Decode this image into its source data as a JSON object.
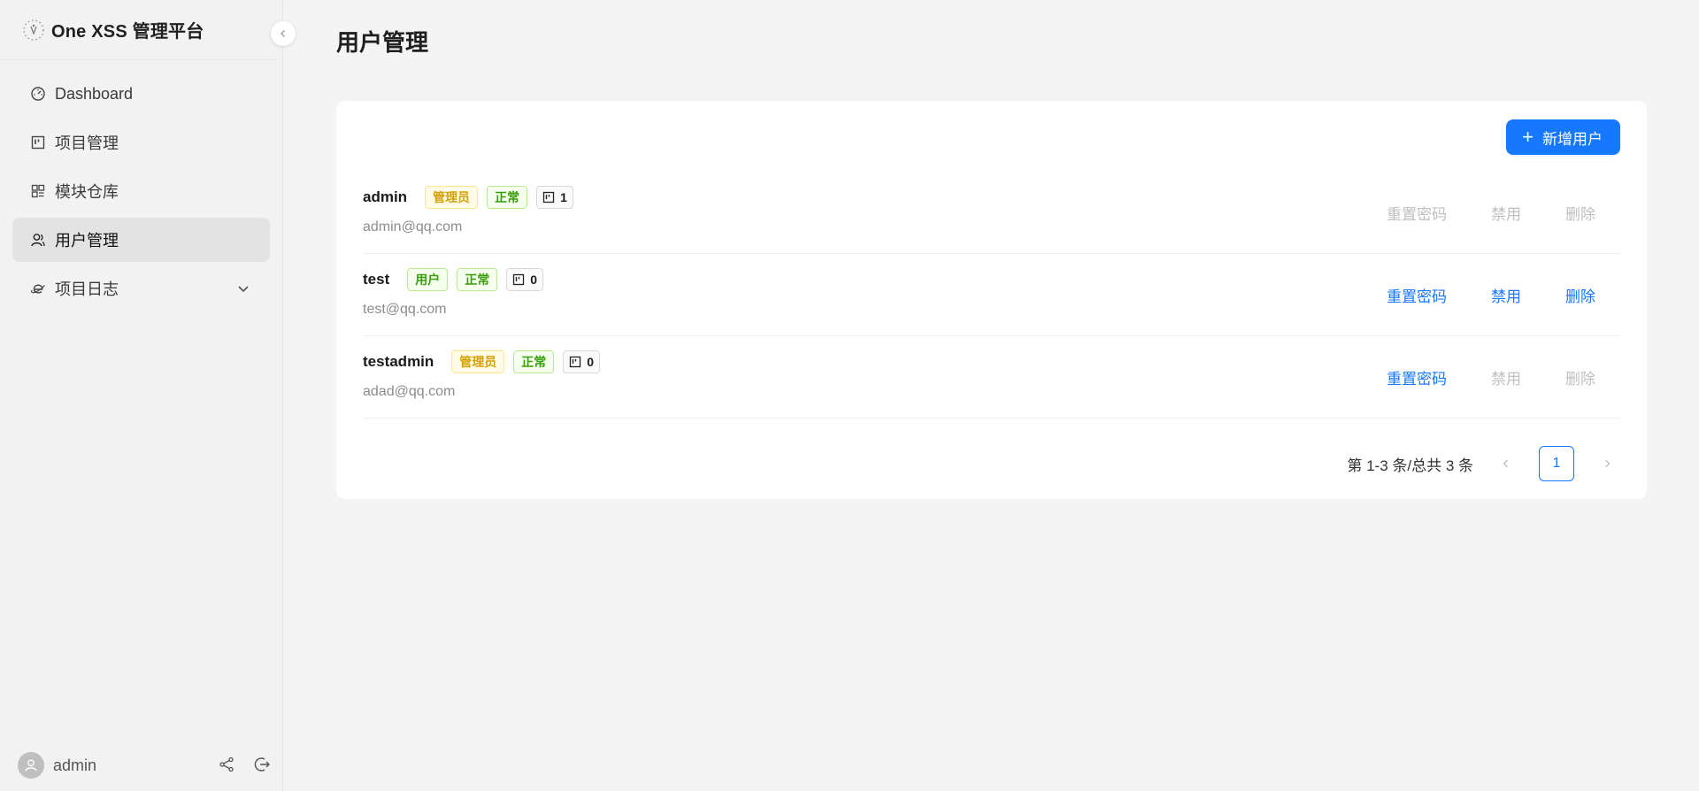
{
  "app": {
    "title": "One XSS 管理平台"
  },
  "sidebar": {
    "items": [
      {
        "label": "Dashboard",
        "icon": "dashboard-icon"
      },
      {
        "label": "项目管理",
        "icon": "project-icon"
      },
      {
        "label": "模块仓库",
        "icon": "module-icon"
      },
      {
        "label": "用户管理",
        "icon": "users-icon",
        "active": true
      },
      {
        "label": "项目日志",
        "icon": "log-icon",
        "expandable": true
      }
    ],
    "footer": {
      "username": "admin"
    }
  },
  "main": {
    "title": "用户管理",
    "add_button_label": "新增用户",
    "users": [
      {
        "name": "admin",
        "role": "管理员",
        "status": "正常",
        "projects": "1",
        "email": "admin@qq.com",
        "actions": {
          "reset": "重置密码",
          "disable": "禁用",
          "delete": "删除"
        },
        "actions_enabled": false
      },
      {
        "name": "test",
        "role": "用户",
        "status": "正常",
        "projects": "0",
        "email": "test@qq.com",
        "actions": {
          "reset": "重置密码",
          "disable": "禁用",
          "delete": "删除"
        },
        "actions_enabled": true
      },
      {
        "name": "testadmin",
        "role": "管理员",
        "status": "正常",
        "projects": "0",
        "email": "adad@qq.com",
        "actions": {
          "reset": "重置密码",
          "disable": "禁用",
          "delete": "删除"
        },
        "actions_enabled": "partial"
      }
    ],
    "pagination": {
      "total_text": "第 1-3 条/总共 3 条",
      "current_page": "1"
    }
  },
  "colors": {
    "primary": "#1677ff",
    "admin_tag": "#d4a106",
    "success_tag": "#389e0d",
    "disabled": "#bfbfbf"
  }
}
